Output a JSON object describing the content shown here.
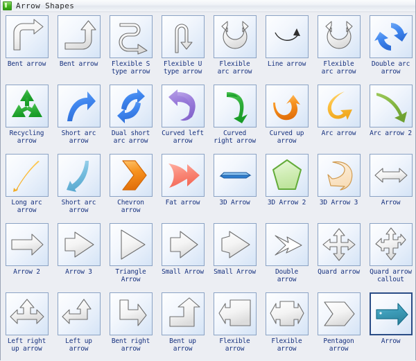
{
  "window": {
    "title": "Arrow Shapes",
    "icon": "green-shape-library-icon"
  },
  "palette": {
    "columns": 8,
    "rows": 5,
    "selected_index": 39,
    "colors": {
      "tile_border": "#8aa2c4",
      "tile_selected_border": "#2a4c86",
      "label_text": "#15307e",
      "panel_background": "#eceef3",
      "titlebar_text": "#2b2b2b"
    },
    "items": [
      {
        "label": "Bent arrow",
        "icon": "bent-arrow-shape",
        "style": "gray"
      },
      {
        "label": "Bent arrow",
        "icon": "bent-arrow-up-shape",
        "style": "gray"
      },
      {
        "label": "Flexible S\ntype arrow",
        "icon": "flexible-s-type-arrow-shape",
        "style": "gray"
      },
      {
        "label": "Flexible U\ntype arrow",
        "icon": "flexible-u-type-arrow-shape",
        "style": "gray"
      },
      {
        "label": "Flexible\narc arrow",
        "icon": "flexible-arc-arrow-shape",
        "style": "gray"
      },
      {
        "label": "Line arrow",
        "icon": "line-arrow-shape",
        "style": "line"
      },
      {
        "label": "Flexible\narc arrow",
        "icon": "flexible-arc-arrow-2-shape",
        "style": "gray"
      },
      {
        "label": "Double arc\narrow",
        "icon": "double-arc-arrow-shape",
        "style": "blue"
      },
      {
        "label": "Recycling\narrow",
        "icon": "recycling-arrow-shape",
        "style": "green"
      },
      {
        "label": "Short arc\narrow",
        "icon": "short-arc-arrow-shape",
        "style": "blue"
      },
      {
        "label": "Dual short\narc arrow",
        "icon": "dual-short-arc-arrow-shape",
        "style": "blue"
      },
      {
        "label": "Curved left\narrow",
        "icon": "curved-left-arrow-shape",
        "style": "purple"
      },
      {
        "label": "Curved\nright arrow",
        "icon": "curved-right-arrow-shape",
        "style": "green"
      },
      {
        "label": "Curved up\narrow",
        "icon": "curved-up-arrow-shape",
        "style": "orange"
      },
      {
        "label": "Arc arrow",
        "icon": "arc-arrow-shape",
        "style": "yellow"
      },
      {
        "label": "Arc arrow 2",
        "icon": "arc-arrow-2-shape",
        "style": "olive"
      },
      {
        "label": "Long arc\narrow",
        "icon": "long-arc-arrow-shape",
        "style": "yellow"
      },
      {
        "label": "Short arc\narrow",
        "icon": "short-arc-arrow-2-shape",
        "style": "lightblue"
      },
      {
        "label": "Chevron\narrow",
        "icon": "chevron-arrow-shape",
        "style": "orange"
      },
      {
        "label": "Fat arrow",
        "icon": "fat-arrow-shape",
        "style": "red"
      },
      {
        "label": "3D Arrow",
        "icon": "3d-arrow-shape",
        "style": "blue"
      },
      {
        "label": "3D Arrow 2",
        "icon": "3d-arrow-2-shape",
        "style": "green"
      },
      {
        "label": "3D Arrow 3",
        "icon": "3d-arrow-3-shape",
        "style": "peach"
      },
      {
        "label": "Arrow",
        "icon": "double-headed-arrow-shape",
        "style": "gray"
      },
      {
        "label": "Arrow 2",
        "icon": "arrow-2-shape",
        "style": "gray"
      },
      {
        "label": "Arrow 3",
        "icon": "arrow-3-shape",
        "style": "gray"
      },
      {
        "label": "Triangle\nArrow",
        "icon": "triangle-arrow-shape",
        "style": "gray"
      },
      {
        "label": "Small Arrow",
        "icon": "small-arrow-shape",
        "style": "gray"
      },
      {
        "label": "Small Arrow",
        "icon": "small-arrow-2-shape",
        "style": "gray"
      },
      {
        "label": "Double\narrow",
        "icon": "double-arrow-shape",
        "style": "outline"
      },
      {
        "label": "Quard arrow",
        "icon": "quad-arrow-shape",
        "style": "gray"
      },
      {
        "label": "Quard arrow\ncallout",
        "icon": "quad-arrow-callout-shape",
        "style": "gray"
      },
      {
        "label": "Left right\nup arrow",
        "icon": "left-right-up-arrow-shape",
        "style": "gray"
      },
      {
        "label": "Left up\narrow",
        "icon": "left-up-arrow-shape",
        "style": "gray"
      },
      {
        "label": "Bent right\narrow",
        "icon": "bent-right-arrow-shape",
        "style": "gray"
      },
      {
        "label": "Bent up\narrow",
        "icon": "bent-up-arrow-shape",
        "style": "gray"
      },
      {
        "label": "Flexible\narrow",
        "icon": "flexible-arrow-shape",
        "style": "gray"
      },
      {
        "label": "Flexible\narrow",
        "icon": "flexible-arrow-2-shape",
        "style": "gray"
      },
      {
        "label": "Pentagon\narrow",
        "icon": "pentagon-arrow-shape",
        "style": "gray"
      },
      {
        "label": "Arrow",
        "icon": "teal-arrow-shape",
        "style": "teal"
      }
    ]
  }
}
